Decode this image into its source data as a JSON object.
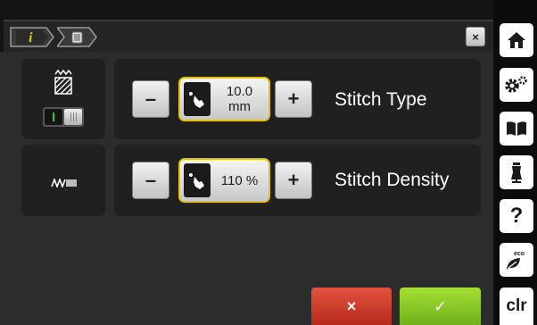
{
  "rows": [
    {
      "value": "10.0 mm",
      "value_line1": "10.0",
      "value_line2": "mm",
      "label": "Stitch Type"
    },
    {
      "value": "110 %",
      "label": "Stitch Density"
    }
  ],
  "controls": {
    "decrement_symbol": "–",
    "increment_symbol": "+"
  },
  "actions": {
    "cancel_symbol": "×",
    "confirm_symbol": "✓"
  },
  "sidebar": {
    "items": [
      {
        "icon": "home-icon"
      },
      {
        "icon": "settings-gears-icon"
      },
      {
        "icon": "tutorial-book-icon"
      },
      {
        "icon": "sewing-consultant-icon"
      },
      {
        "icon": "help-icon",
        "label": "?"
      },
      {
        "icon": "eco-mode-icon",
        "label": "eco"
      },
      {
        "icon": "clear-icon",
        "label": "clr"
      }
    ]
  },
  "colors": {
    "highlight": "#e7c300",
    "info_accent": "#e7c300",
    "toggle_on": "#33cc33",
    "cancel": "#c9382a",
    "confirm": "#8cc926"
  }
}
